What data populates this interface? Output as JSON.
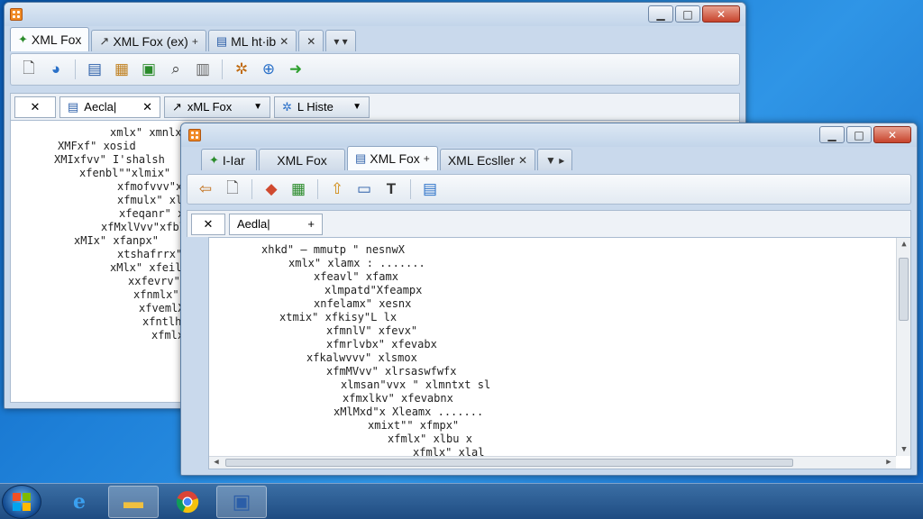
{
  "back_window": {
    "tabs": [
      {
        "label": "XML Fox",
        "icon": "arrow-icon"
      },
      {
        "label": "XML Fox (ex)",
        "suffix": "+"
      },
      {
        "label": "ML ht·ib",
        "suffix": "✕"
      }
    ],
    "tab_close": "✕",
    "tab_more": "▾ ▾",
    "doc_close": "✕",
    "doc_tab": {
      "label": "Aecla|",
      "close": "✕"
    },
    "combo1": {
      "label": "xML Fox",
      "arrow": "▼"
    },
    "combo2": {
      "label": "L Histe",
      "arrow": "▼"
    },
    "code_lines": [
      "xmlx\" xmnlx",
      "XMFxf\" xosid",
      "XMIxfvv\" I'shalsh",
      "xfenbl\"\"xlmix\"",
      "xfmofvvv\"xk",
      "xfmulx\" xlsk",
      "xfeqanr\" xfe",
      "xfMxlVvv\"xfbl",
      "xMIx\" xfanpx\"",
      "xtshafrrx\" xlx",
      "xMlx\" xfeilud",
      "xxfevrv\" xfvl",
      "xfnmlx\" xle",
      "xfvemlX\" xl",
      "xfntlhx\"x",
      "xfmlxn"
    ]
  },
  "front_window": {
    "tabs": [
      {
        "label": "I-Iar",
        "icon": "arrow-icon"
      },
      {
        "label": "XML Fox"
      },
      {
        "label": "XML Fox",
        "suffix": "+"
      },
      {
        "label": "XML Ecsller",
        "suffix": "✕"
      }
    ],
    "tab_more": "▼ ▸",
    "doc_close": "✕",
    "doc_tab": {
      "label": "Aedla|",
      "add": "+"
    },
    "code_lines": [
      "xhkd\" – mmutp \" nesnwX",
      "xmlx\" xlamx : .......",
      "xfeavl\" xfamx",
      "xlmpatd\"Xfeampx",
      "xnfelamx\" xesnx",
      "xtmix\" xfkisy\"L lx",
      "xfmnlV\" xfevx\"",
      "xfmrlvbx\" xfevabx",
      "xfkalwvvv\" xlsmox",
      "xfmMVvv\" xlrsaswfwfx",
      "xlmsan\"vvx \" xlmntxt sl",
      "xfmxlkv\" xfevabnx",
      "xMlMxd\"x Xleamx .......",
      "xmixt\"\" xfmpx\"",
      "xfmlx\" xlbu x",
      "xfmlx\" xlal"
    ]
  },
  "colors": {
    "desktop": "#1e80d8",
    "window_frame": "#c9d9ec",
    "close_button": "#c7432c",
    "taskbar": "#1f4c82"
  },
  "taskbar": {
    "items": [
      "internet-explorer-icon",
      "folder-icon",
      "chrome-icon",
      "xml-fox-icon"
    ]
  },
  "caption": {
    "minimize": "▁",
    "maximize": "□",
    "close": "✕"
  }
}
